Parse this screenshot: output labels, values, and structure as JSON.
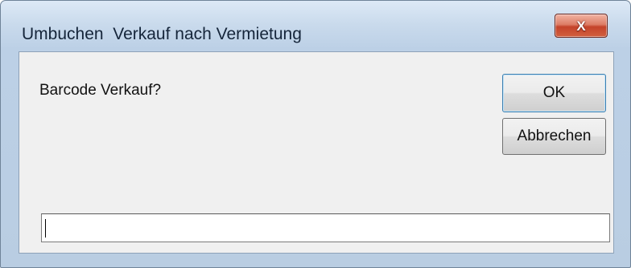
{
  "window": {
    "title": "Umbuchen  Verkauf nach Vermietung",
    "close_symbol": "X"
  },
  "dialog": {
    "prompt": "Barcode Verkauf?",
    "ok_label": "OK",
    "cancel_label": "Abbrechen",
    "input_value": ""
  },
  "colors": {
    "close_button": "#c4432a",
    "frame": "#bcd0e6",
    "client_bg": "#f0f0f0",
    "default_button_border": "#3c7fb1"
  },
  "icons": {
    "close": "close-icon"
  }
}
